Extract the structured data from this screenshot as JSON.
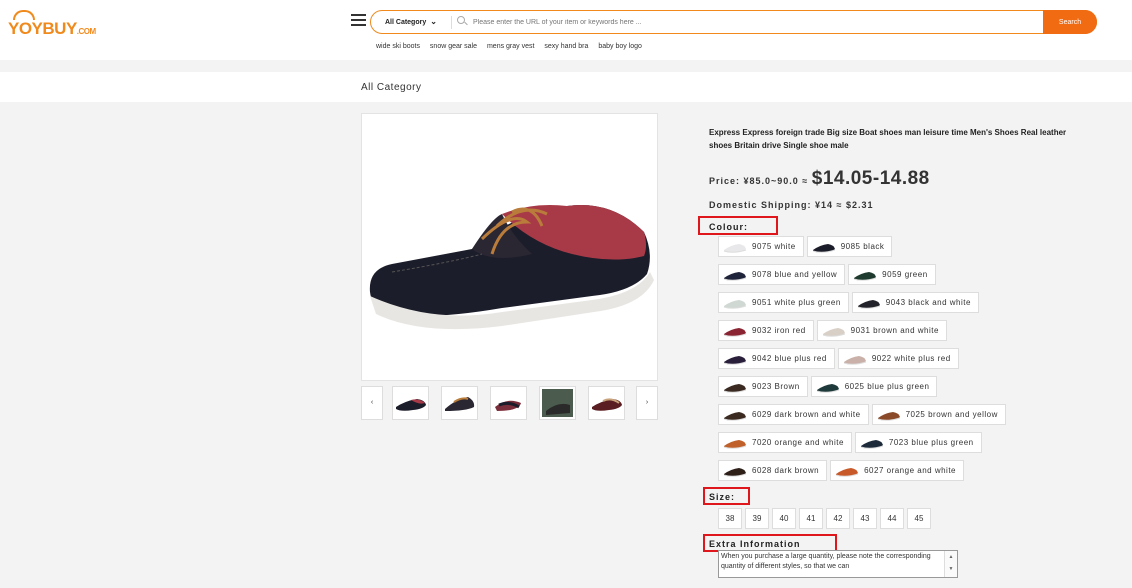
{
  "header": {
    "logo_text": "YOYBUY",
    "logo_suffix": ".COM",
    "category_label": "All Category",
    "search_placeholder": "Please enter the URL of your item or keywords here ...",
    "search_button": "Search",
    "hot_searches": [
      "wide ski boots",
      "snow gear sale",
      "mens gray vest",
      "sexy hand bra",
      "baby boy logo"
    ]
  },
  "breadcrumb": "All Category",
  "product": {
    "title": "Express Express foreign trade Big size Boat shoes man leisure time Men's Shoes Real leather shoes Britain drive Single shoe male",
    "price_label": "Price: ¥85.0~90.0 ≈ ",
    "price_usd": "$14.05-14.88",
    "shipping": "Domestic Shipping: ¥14 ≈ $2.31",
    "thumb_prev": "‹",
    "thumb_next": "›",
    "colour_label": "Colour:",
    "colour_rows": [
      [
        "9075 white",
        "9085 black"
      ],
      [
        "9078 blue and yellow",
        "9059 green"
      ],
      [
        "9051 white plus green",
        "9043 black and white"
      ],
      [
        "9032 iron red",
        "9031 brown and white"
      ],
      [
        "9042 blue plus red",
        "9022 white plus red"
      ],
      [
        "9023 Brown",
        "6025 blue plus green"
      ],
      [
        "6029 dark brown and white",
        "7025 brown and yellow"
      ],
      [
        "7020 orange and white",
        "7023 blue plus green"
      ],
      [
        "6028 dark brown",
        "6027 orange and white"
      ]
    ],
    "size_label": "Size:",
    "sizes": [
      "38",
      "39",
      "40",
      "41",
      "42",
      "43",
      "44",
      "45"
    ],
    "extra_label": "Extra Information",
    "extra_text": "When you purchase a large quantity, please note the corresponding quantity of different styles, so that we can"
  },
  "colors": {
    "accent": "#f08a1d",
    "search_button": "#f06b12",
    "highlight_box": "#e0161d"
  }
}
